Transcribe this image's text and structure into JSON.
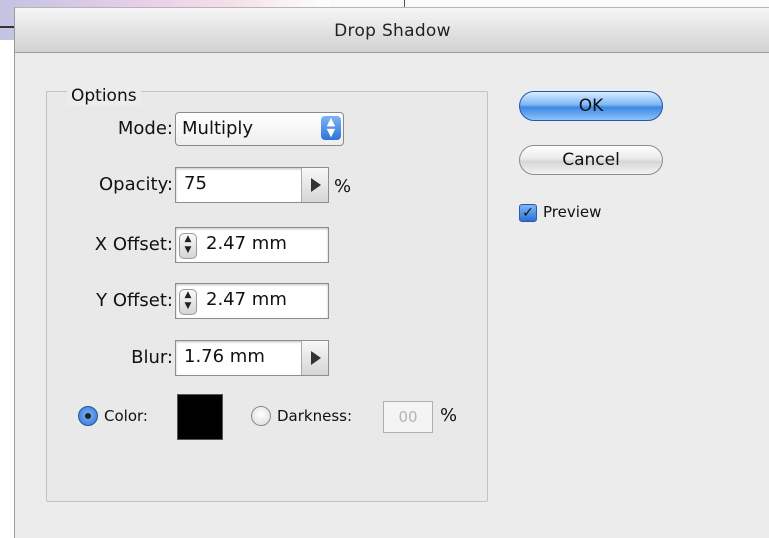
{
  "window": {
    "title": "Drop Shadow"
  },
  "options": {
    "group_label": "Options",
    "mode": {
      "label": "Mode:",
      "value": "Multiply"
    },
    "opacity": {
      "label": "Opacity:",
      "value": "75",
      "unit": "%"
    },
    "x_offset": {
      "label": "X Offset:",
      "value": "2.47 mm"
    },
    "y_offset": {
      "label": "Y Offset:",
      "value": "2.47 mm"
    },
    "blur": {
      "label": "Blur:",
      "value": "1.76 mm"
    },
    "color": {
      "label": "Color:",
      "selected": true,
      "swatch": "#000000"
    },
    "darkness": {
      "label": "Darkness:",
      "selected": false,
      "value": "00",
      "unit": "%"
    }
  },
  "buttons": {
    "ok": "OK",
    "cancel": "Cancel"
  },
  "preview": {
    "label": "Preview",
    "checked": true
  }
}
